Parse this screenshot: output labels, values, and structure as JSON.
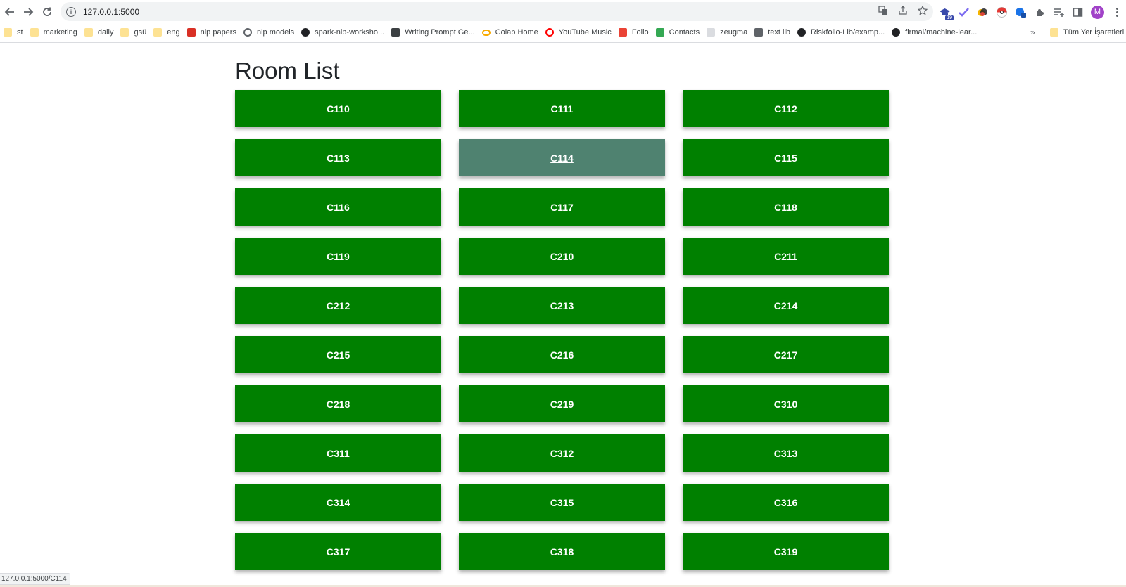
{
  "browser": {
    "url": "127.0.0.1:5000",
    "status_url": "127.0.0.1:5000/C114",
    "avatar_letter": "M",
    "ext_badge": "19"
  },
  "bookmarks": [
    {
      "label": "st",
      "icon": "folder-icon"
    },
    {
      "label": "marketing",
      "icon": "folder-icon"
    },
    {
      "label": "daily",
      "icon": "folder-icon"
    },
    {
      "label": "gsü",
      "icon": "folder-icon"
    },
    {
      "label": "eng",
      "icon": "folder-icon"
    },
    {
      "label": "nlp papers",
      "icon": "paper-icon",
      "color": "#d93025"
    },
    {
      "label": "nlp models",
      "icon": "globe-icon",
      "color": "#5f6368"
    },
    {
      "label": "spark-nlp-worksho...",
      "icon": "github-icon",
      "color": "#202124"
    },
    {
      "label": "Writing Prompt Ge...",
      "icon": "s-icon",
      "color": "#3c4043"
    },
    {
      "label": "Colab Home",
      "icon": "colab-icon",
      "color": "#f9ab00"
    },
    {
      "label": "YouTube Music",
      "icon": "youtube-music-icon",
      "color": "#ff0000"
    },
    {
      "label": "Folio",
      "icon": "folio-icon",
      "color": "#ea4335"
    },
    {
      "label": "Contacts",
      "icon": "contacts-icon",
      "color": "#34a853"
    },
    {
      "label": "zeugma",
      "icon": "zeugma-icon",
      "color": "#dadce0"
    },
    {
      "label": "text lib",
      "icon": "book-icon",
      "color": "#5f6368"
    },
    {
      "label": "Riskfolio-Lib/examp...",
      "icon": "github-icon",
      "color": "#202124"
    },
    {
      "label": "firmai/machine-lear...",
      "icon": "github-icon",
      "color": "#202124"
    }
  ],
  "bookmarks_more": "»",
  "other_bookmarks": "Tüm Yer İşaretleri",
  "page": {
    "title": "Room List"
  },
  "rooms": [
    "C110",
    "C111",
    "C112",
    "C113",
    "C114",
    "C115",
    "C116",
    "C117",
    "C118",
    "C119",
    "C210",
    "C211",
    "C212",
    "C213",
    "C214",
    "C215",
    "C216",
    "C217",
    "C218",
    "C219",
    "C310",
    "C311",
    "C312",
    "C313",
    "C314",
    "C315",
    "C316",
    "C317",
    "C318",
    "C319"
  ],
  "hovered_room": "C114",
  "colors": {
    "room_bg": "#008000",
    "room_hover_bg": "#4f8270",
    "room_text": "#ffffff"
  }
}
